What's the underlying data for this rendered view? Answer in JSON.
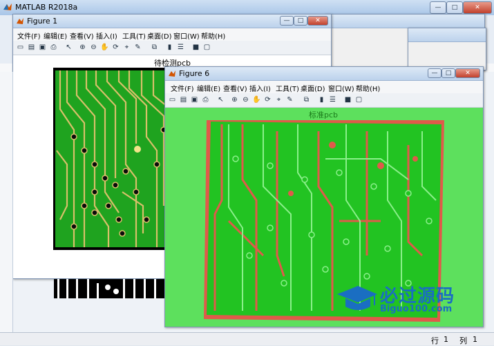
{
  "main": {
    "title": "MATLAB R2018a"
  },
  "figure1": {
    "title": "Figure 1",
    "axes_title": "待检测pcb"
  },
  "figure6": {
    "title": "Figure 6",
    "axes_title": "标准pcb"
  },
  "menu": [
    {
      "label": "文件(F)"
    },
    {
      "label": "编辑(E)"
    },
    {
      "label": "查看(V)"
    },
    {
      "label": "插入(I)"
    },
    {
      "label": "工具(T)"
    },
    {
      "label": "桌面(D)"
    },
    {
      "label": "窗口(W)"
    },
    {
      "label": "帮助(H)"
    }
  ],
  "watermark": {
    "cn": "必过源码",
    "url": "Biguo100.com"
  },
  "status": {
    "row_label": "行",
    "row_value": "1",
    "col_label": "列",
    "col_value": "1"
  },
  "colors": {
    "pcb_green": "#1fa31f",
    "trace_gold": "#d8c06a",
    "diff_green": "#5de05d",
    "diff_red": "#e05a4a"
  }
}
